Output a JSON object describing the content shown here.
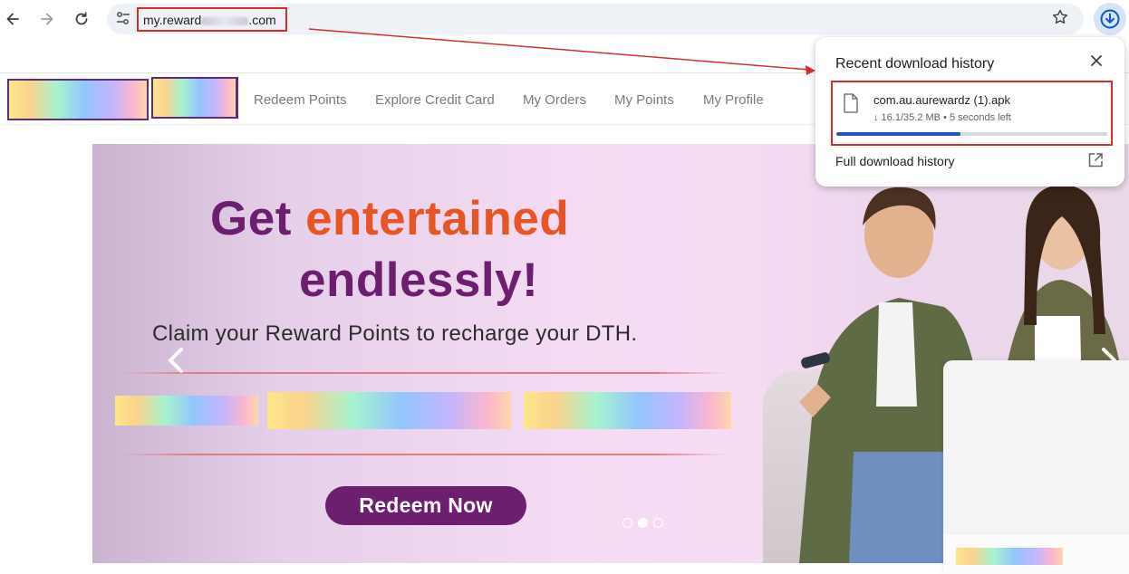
{
  "browser": {
    "url_prefix": "my.reward",
    "url_suffix": ".com",
    "back_icon": "back-arrow-icon",
    "forward_icon": "forward-arrow-icon",
    "reload_icon": "reload-icon",
    "bookmark_icon": "star-icon",
    "download_icon": "download-icon"
  },
  "nav": {
    "links": [
      "Redeem Points",
      "Explore Credit Card",
      "My Orders",
      "My Points",
      "My Profile"
    ]
  },
  "banner": {
    "title_part1": "Get ",
    "title_accent": "entertained",
    "title_line2": "endlessly!",
    "subtitle": "Claim your Reward Points to recharge your DTH.",
    "cta": "Redeem Now",
    "slide_count": 3,
    "active_slide": 2,
    "colors": {
      "title": "#6b1f6e",
      "accent": "#e55526",
      "cta_bg": "#6b1f6e"
    }
  },
  "downloads": {
    "title": "Recent download history",
    "item": {
      "filename": "com.au.aurewardz (1).apk",
      "status": "↓ 16.1/35.2 MB • 5 seconds left",
      "progress": 0.457
    },
    "full_history": "Full download history",
    "colors": {
      "progress": "#1a56c7",
      "highlight": "#d32f2f"
    }
  }
}
